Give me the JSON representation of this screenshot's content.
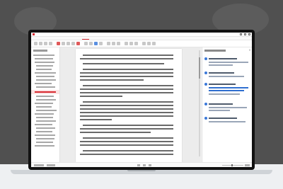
{
  "window": {
    "title": ""
  },
  "ribbon": {
    "tabs": [
      "",
      "",
      "",
      "",
      "",
      ""
    ],
    "active_tab_index": 1
  },
  "sidebar": {
    "heading": "",
    "active_item_index": 11
  },
  "document": {
    "watermark": ""
  },
  "panel": {
    "heading": "",
    "comments": [
      {
        "author": "",
        "text": ""
      },
      {
        "author": "",
        "text": ""
      },
      {
        "author": "",
        "text": ""
      },
      {
        "author": "",
        "text": ""
      },
      {
        "author": "",
        "text": ""
      }
    ]
  },
  "status": {
    "page_info": "",
    "zoom": ""
  },
  "colors": {
    "accent": "#d7282f",
    "comment_avatar": "#3a78d8",
    "link_blue": "#2f6fd0",
    "watermark": "#e07030"
  },
  "icons": [
    "app-icon",
    "minimize-icon",
    "maximize-icon",
    "close-icon",
    "panel-close-icon",
    "avatar-icon"
  ]
}
